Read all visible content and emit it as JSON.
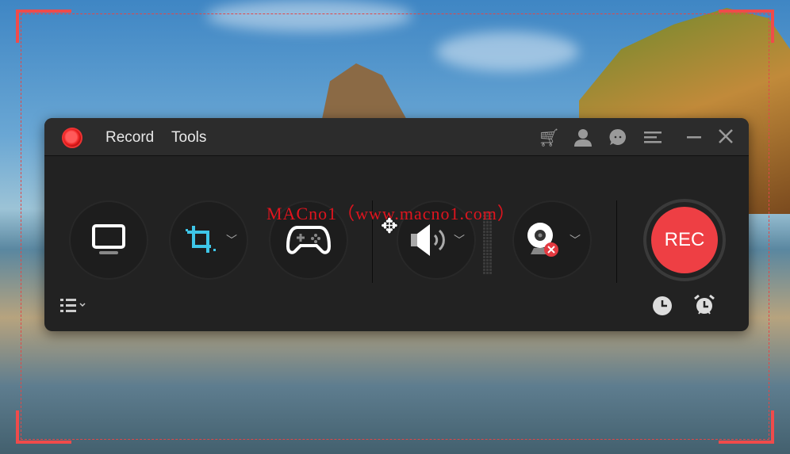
{
  "menu": {
    "record": "Record",
    "tools": "Tools"
  },
  "title_icons": [
    "cart-icon",
    "account-icon",
    "chat-icon",
    "menu-icon",
    "minimize-icon",
    "close-icon"
  ],
  "modes": [
    {
      "name": "screen",
      "icon": "monitor-icon"
    },
    {
      "name": "region",
      "icon": "crop-icon",
      "color": "#3ec6e8"
    },
    {
      "name": "game",
      "icon": "gamepad-icon"
    },
    {
      "name": "audio",
      "icon": "speaker-icon"
    },
    {
      "name": "webcam",
      "icon": "webcam-icon",
      "status": "disabled"
    }
  ],
  "rec": {
    "label": "REC",
    "color": "#ee3f44"
  },
  "watermark": "MACno1（www.macno1.com）",
  "accent": "#ef4b4b"
}
